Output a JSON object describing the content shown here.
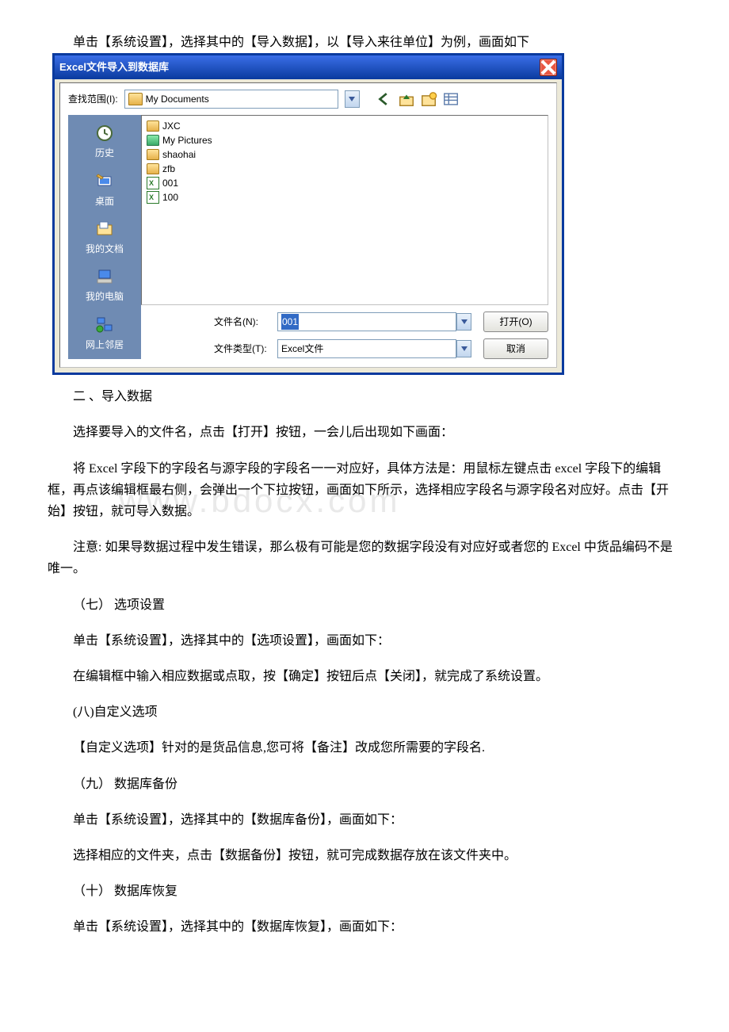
{
  "intro_text": "单击【系统设置】，选择其中的【导入数据】，以【导入来往单位】为例，画面如下",
  "dialog": {
    "title": "Excel文件导入到数据库",
    "lookin_label": "查找范围(I):",
    "lookin_value": "My Documents",
    "places": {
      "history": "历史",
      "desktop": "桌面",
      "mydocs": "我的文档",
      "mycomputer": "我的电脑",
      "network": "网上邻居"
    },
    "items": {
      "folder1": "JXC",
      "folder2": "My Pictures",
      "folder3": "shaohai",
      "folder4": "zfb",
      "file1": "001",
      "file2": "100"
    },
    "filename_label": "文件名(N):",
    "filename_value": "001",
    "filetype_label": "文件类型(T):",
    "filetype_value": "Excel文件",
    "open_btn": "打开(O)",
    "cancel_btn": "取消"
  },
  "body": {
    "sec2_title": "二 、导入数据",
    "p1": "选择要导入的文件名，点击【打开】按钮，一会儿后出现如下画面：",
    "p2": "将 Excel 字段下的字段名与源字段的字段名一一对应好，具体方法是：用鼠标左键点击 excel 字段下的编辑框，再点该编辑框最右侧，会弹出一个下拉按钮，画面如下所示，选择相应字段名与源字段名对应好。点击【开始】按钮，就可导入数据。",
    "p3": "注意: 如果导数据过程中发生错误，那么极有可能是您的数据字段没有对应好或者您的 Excel 中货品编码不是唯一。",
    "sec7": "（七） 选项设置",
    "p7a": "单击【系统设置】，选择其中的【选项设置】，画面如下：",
    "p7b": "在编辑框中输入相应数据或点取，按【确定】按钮后点【关闭】，就完成了系统设置。",
    "sec8": "(八)自定义选项",
    "p8": "【自定义选项】针对的是货品信息,您可将【备注】改成您所需要的字段名.",
    "sec9": "（九） 数据库备份",
    "p9a": "单击【系统设置】，选择其中的【数据库备份】，画面如下：",
    "p9b": "选择相应的文件夹，点击【数据备份】按钮，就可完成数据存放在该文件夹中。",
    "sec10": "（十） 数据库恢复",
    "p10": "单击【系统设置】，选择其中的【数据库恢复】，画面如下："
  },
  "watermark": "www.bdocx.com"
}
